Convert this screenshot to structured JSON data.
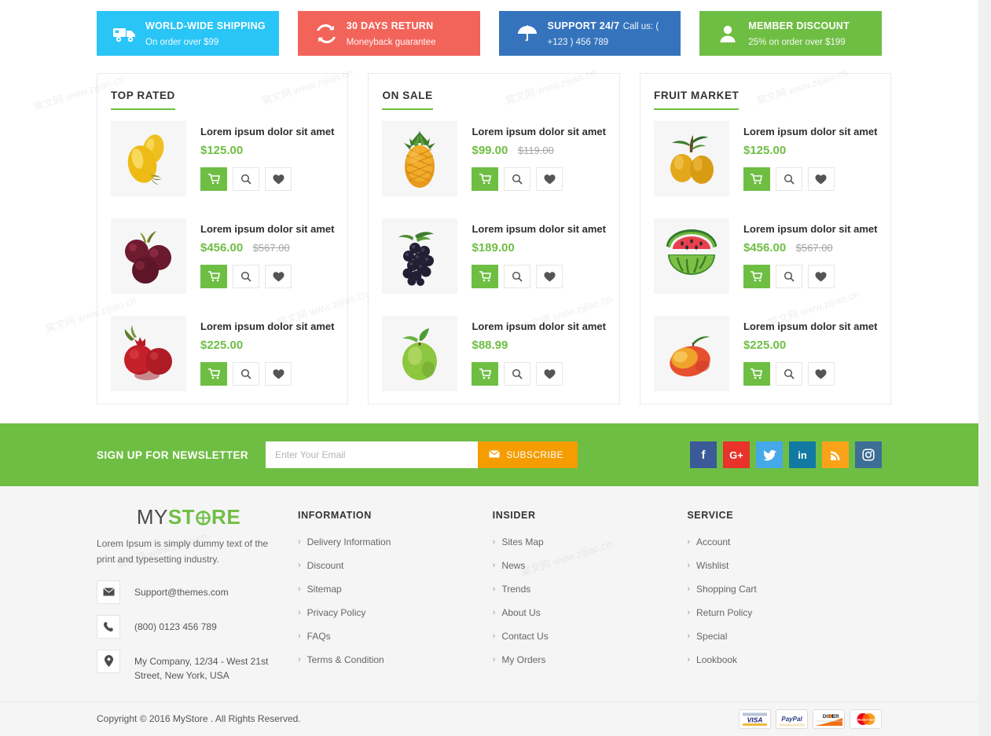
{
  "service_bar": [
    {
      "title": "WORLD-WIDE SHIPPING",
      "sub": "On order over $99",
      "color": "#29c5f6",
      "icon": "truck-icon"
    },
    {
      "title": "30 DAYS RETURN",
      "sub": "Moneyback guarantee",
      "color": "#f2645a",
      "icon": "refresh-icon"
    },
    {
      "title": "SUPPORT 24/7",
      "sub": "Call us: ( +123 ) 456 789",
      "color": "#3574bd",
      "icon": "umbrella-icon"
    },
    {
      "title": "MEMBER DISCOUNT",
      "sub": "25% on order over $199",
      "color": "#6fbe44",
      "icon": "user-icon"
    }
  ],
  "panels": [
    {
      "title": "TOP RATED",
      "products": [
        {
          "name": "Lorem ipsum dolor sit amet",
          "price": "$125.00",
          "old_price": "",
          "image": "yellow-tomato-image"
        },
        {
          "name": "Lorem ipsum dolor sit amet",
          "price": "$456.00",
          "old_price": "$567.00",
          "image": "plum-image"
        },
        {
          "name": "Lorem ipsum dolor sit amet",
          "price": "$225.00",
          "old_price": "",
          "image": "pomegranate-image"
        }
      ]
    },
    {
      "title": "ON SALE",
      "products": [
        {
          "name": "Lorem ipsum dolor sit amet",
          "price": "$99.00",
          "old_price": "$119.00",
          "image": "pineapple-image"
        },
        {
          "name": "Lorem ipsum dolor sit amet",
          "price": "$189.00",
          "old_price": "",
          "image": "grapes-image"
        },
        {
          "name": "Lorem ipsum dolor sit amet",
          "price": "$88.99",
          "old_price": "",
          "image": "green-apple-image"
        }
      ]
    },
    {
      "title": "FRUIT MARKET",
      "products": [
        {
          "name": "Lorem ipsum dolor sit amet",
          "price": "$125.00",
          "old_price": "",
          "image": "loquat-image"
        },
        {
          "name": "Lorem ipsum dolor sit amet",
          "price": "$456.00",
          "old_price": "$567.00",
          "image": "watermelon-image"
        },
        {
          "name": "Lorem ipsum dolor sit amet",
          "price": "$225.00",
          "old_price": "",
          "image": "mango-image"
        }
      ]
    }
  ],
  "product_actions": {
    "cart": "add-to-cart",
    "quickview": "quick-view",
    "wishlist": "add-to-wishlist"
  },
  "newsletter": {
    "label": "SIGN UP FOR NEWSLETTER",
    "placeholder": "Enter Your Email",
    "value": "",
    "button": "SUBSCRIBE",
    "bar_color": "#6fbe44",
    "button_color": "#f59c00"
  },
  "socials": [
    {
      "name": "facebook",
      "glyph": "f",
      "color": "#3a5a98"
    },
    {
      "name": "google-plus",
      "glyph": "G+",
      "color": "#e8322a"
    },
    {
      "name": "twitter",
      "glyph": "",
      "color": "#45a8e8"
    },
    {
      "name": "linkedin",
      "glyph": "in",
      "color": "#1279a3"
    },
    {
      "name": "rss",
      "glyph": "",
      "color": "#fba318"
    },
    {
      "name": "instagram",
      "glyph": "",
      "color": "#3d6e96"
    }
  ],
  "footer": {
    "logo": {
      "part1": "MY",
      "part2": "ST",
      "part3": "RE"
    },
    "description": "Lorem Ipsum is simply dummy text of the print and typesetting industry.",
    "contacts": [
      {
        "icon": "mail-icon",
        "text": "Support@themes.com"
      },
      {
        "icon": "phone-icon",
        "text": "(800) 0123 456 789"
      },
      {
        "icon": "location-icon",
        "text": "My Company, 12/34 - West 21st Street, New York, USA"
      }
    ],
    "columns": [
      {
        "heading": "INFORMATION",
        "links": [
          "Delivery Information",
          "Discount",
          "Sitemap",
          "Privacy Policy",
          "FAQs",
          "Terms & Condition"
        ]
      },
      {
        "heading": "INSIDER",
        "links": [
          "Sites Map",
          "News",
          "Trends",
          "About Us",
          "Contact Us",
          "My Orders"
        ]
      },
      {
        "heading": "SERVICE",
        "links": [
          "Account",
          "Wishlist",
          "Shopping Cart",
          "Return Policy",
          "Special",
          "Lookbook"
        ]
      }
    ]
  },
  "copyright": "Copyright © 2016 MyStore . All Rights Reserved.",
  "payments": [
    "visa",
    "paypal",
    "discover",
    "mastercard"
  ],
  "watermarks": [
    "窝文网 www.zijiao.cn",
    "窝文网 www.zijiao.cn",
    "窝文网 www.zijiao.cn",
    "窝文网 www.zijiao.cn",
    "窝文网 www.zijiao.cn",
    "窝文网 www.zijiao.cn",
    "窝文网 www.zijiao.cn",
    "窝文网 www.zijiao.cn",
    "窝文网 www.zijiao.cn",
    "窝文网 www.zijiao.cn"
  ]
}
